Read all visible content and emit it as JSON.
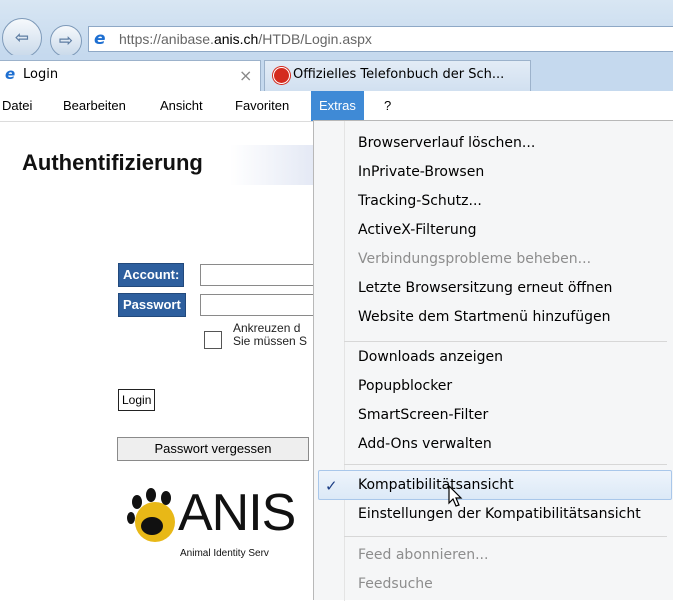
{
  "browser": {
    "url_prefix": "https://anibase.",
    "url_host": "anis.ch",
    "url_path": "/HTDB/Login.aspx",
    "tabs": [
      {
        "label": "Login",
        "active": true,
        "close": "×"
      },
      {
        "label": "Offizielles Telefonbuch der Sch...",
        "active": false
      }
    ]
  },
  "menubar": {
    "items": [
      "Datei",
      "Bearbeiten",
      "Ansicht",
      "Favoriten",
      "Extras",
      "?"
    ]
  },
  "page": {
    "heading": "Authentifizierung",
    "account_label": "Account:",
    "password_label": "Passwort",
    "checkbox_text_line1": "Ankreuzen d",
    "checkbox_text_line2": "Sie müssen S",
    "login_button": "Login",
    "forgot_button": "Passwort vergessen",
    "logo_word": "ANIS",
    "logo_subtitle": "Animal Identity Serv"
  },
  "extras_menu": {
    "items": [
      {
        "label": "Browserverlauf löschen...",
        "disabled": false
      },
      {
        "label": "InPrivate-Browsen",
        "disabled": false
      },
      {
        "label": "Tracking-Schutz...",
        "disabled": false
      },
      {
        "label": "ActiveX-Filterung",
        "disabled": false
      },
      {
        "label": "Verbindungsprobleme beheben...",
        "disabled": true
      },
      {
        "label": "Letzte Browsersitzung erneut öffnen",
        "disabled": false
      },
      {
        "label": "Website dem Startmenü hinzufügen",
        "disabled": false
      },
      {
        "label": "Downloads anzeigen",
        "disabled": false
      },
      {
        "label": "Popupblocker",
        "disabled": false
      },
      {
        "label": "SmartScreen-Filter",
        "disabled": false
      },
      {
        "label": "Add-Ons verwalten",
        "disabled": false
      },
      {
        "label": "Kompatibilitätsansicht",
        "disabled": false,
        "checked": true,
        "highlighted": true
      },
      {
        "label": "Einstellungen der Kompatibilitätsansicht",
        "disabled": false
      },
      {
        "label": "Feed abonnieren...",
        "disabled": true
      },
      {
        "label": "Feedsuche",
        "disabled": true
      }
    ],
    "checkmark": "✓"
  },
  "colors": {
    "menu_active": "#3f8ad6",
    "label_bg": "#2e5f9e"
  }
}
